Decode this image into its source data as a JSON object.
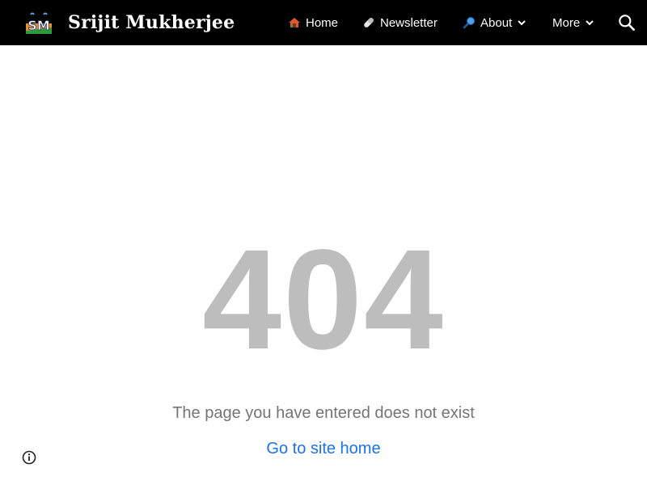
{
  "header": {
    "site_title": "Srijit Mukherjee",
    "logo_text": "SM",
    "background_color": "#000000",
    "nav": [
      {
        "label": "Home",
        "icon": "house-icon"
      },
      {
        "label": "Newsletter",
        "icon": "pill-icon"
      },
      {
        "label": "About",
        "icon": "magnifier-icon",
        "has_dropdown": true
      },
      {
        "label": "More",
        "has_dropdown": true
      }
    ],
    "search_icon": "search-icon"
  },
  "error": {
    "code": "404",
    "message": "The page you have entered does not exist",
    "home_link": "Go to site home",
    "code_color": "#bdbdbd",
    "link_color": "#1a73e8"
  },
  "footer": {
    "info_icon": "info-icon"
  }
}
